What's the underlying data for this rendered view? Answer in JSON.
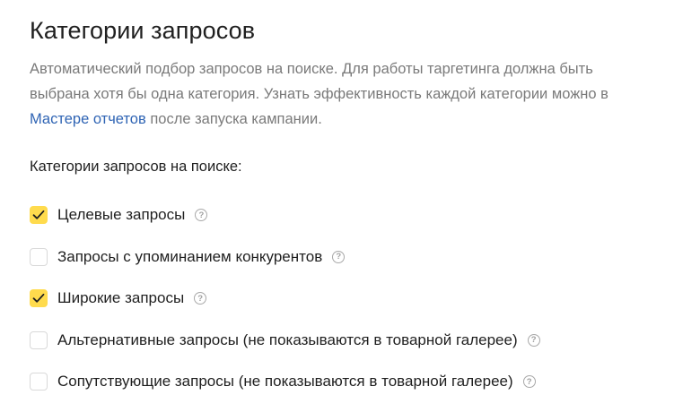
{
  "section": {
    "title": "Категории запросов",
    "description_before_link": "Автоматический подбор запросов на поиске. Для работы таргетинга должна быть выбрана хотя бы одна категория. Узнать эффективность каждой категории можно в ",
    "link_text": "Мастере отчетов",
    "description_after_link": " после запуска кампании.",
    "subheading": "Категории запросов на поиске:"
  },
  "options": [
    {
      "label": "Целевые запросы",
      "checked": true
    },
    {
      "label": "Запросы с упоминанием конкурентов",
      "checked": false
    },
    {
      "label": "Широкие запросы",
      "checked": true
    },
    {
      "label": "Альтернативные запросы (не показываются в товарной галерее)",
      "checked": false
    },
    {
      "label": "Сопутствующие запросы (не показываются в товарной галерее)",
      "checked": false
    }
  ],
  "help_glyph": "?",
  "icons": {
    "check": "checkmark-icon",
    "help": "question-circle-icon"
  },
  "colors": {
    "checkbox_checked": "#ffdb4d",
    "link": "#2f64b4",
    "description": "#7a7a7a"
  }
}
